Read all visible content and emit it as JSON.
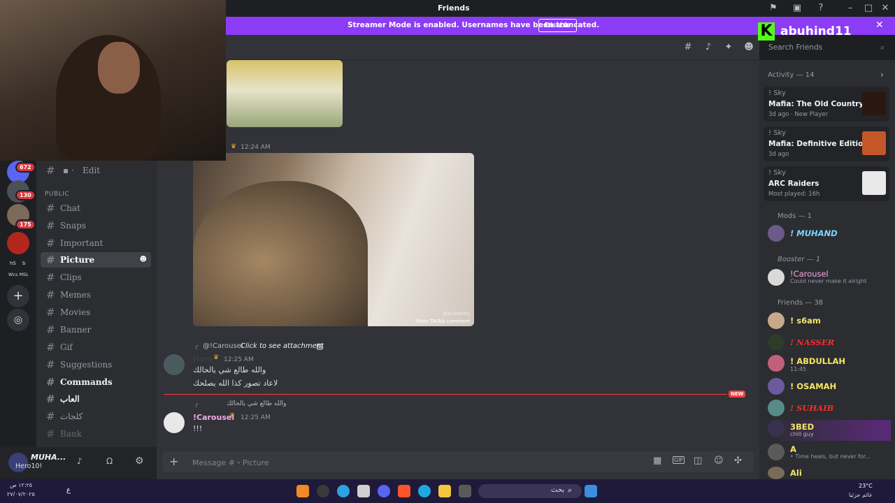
{
  "window": {
    "title": "Friends"
  },
  "banner": {
    "message": "Streamer Mode is enabled. Usernames have been truncated.",
    "disable_label": "Disable"
  },
  "brand": {
    "logo_letter": "K",
    "name": "abuhind11"
  },
  "servers": {
    "badges": [
      "672",
      "130",
      "175"
    ],
    "labels": [
      "hS",
      "b",
      "Wcs MSL"
    ]
  },
  "channels": {
    "edit": "Edit",
    "category_public": "PUBLIC",
    "items": [
      {
        "label": "Chat"
      },
      {
        "label": "Snaps"
      },
      {
        "label": "Important"
      },
      {
        "label": "Picture"
      },
      {
        "label": "Clips"
      },
      {
        "label": "Memes"
      },
      {
        "label": "Movies"
      },
      {
        "label": "Banner"
      },
      {
        "label": "Gif"
      },
      {
        "label": "Suggestions"
      },
      {
        "label": "Commands"
      },
      {
        "label": "العاب"
      },
      {
        "label": "كلجات"
      },
      {
        "label": "Bank"
      }
    ]
  },
  "user_panel": {
    "name": "MUHA...",
    "status": "Hero10!"
  },
  "header": {
    "search_placeholder": "Search Friends"
  },
  "messages": {
    "first_time": "12:24 AM",
    "video_watermark": "@screamfy",
    "video_caption": "From TikTok comment",
    "reply_ref_user": "@!Carousel",
    "reply_ref_text": "Click to see attachment",
    "msg2_author": "Hero",
    "msg2_time": "12:25 AM",
    "msg2_line1": "والله طالع شي يالحالك",
    "msg2_line2": "لاعاد تصور كذا الله يصلحك",
    "new_label": "NEW",
    "msg3_reply": "والله طالع شي يالحالك",
    "msg3_author": "!Carousel",
    "msg3_time": "12:25 AM",
    "msg3_text": "!!!"
  },
  "composer": {
    "placeholder": "Message #・Picture"
  },
  "right": {
    "activity_title": "Activity — 14",
    "activities": [
      {
        "user": "! Sky",
        "game": "Mafia: The Old Country",
        "sub": "3d ago · New Player",
        "art_color": "#2a1810"
      },
      {
        "user": "! Sky",
        "game": "Mafia: Definitive Edition",
        "sub": "3d ago",
        "art_color": "#c4572a"
      },
      {
        "user": "! Sky",
        "game": "ARC Raiders",
        "sub": "Most played: 16h",
        "art_color": "#e9e9e9"
      }
    ],
    "mods_title": "Mods — 1",
    "mods": [
      {
        "name": "! MUHAND",
        "color": "#7dd6ff"
      }
    ],
    "booster_title": "Booster — 1",
    "boosters": [
      {
        "name": "!Carousel",
        "sub": "Could never make it alright",
        "color": "#f7a8e8"
      }
    ],
    "friends_title": "Friends — 38",
    "friends": [
      {
        "name": "! s6am",
        "sub": "",
        "color": "#f5e663"
      },
      {
        "name": "! NASSER",
        "sub": "",
        "color": "#ff2a2a"
      },
      {
        "name": "! ABDULLAH",
        "sub": "11:45",
        "color": "#f5e663"
      },
      {
        "name": "! OSAMAH",
        "sub": "",
        "color": "#f5e663"
      },
      {
        "name": "! SUHAIB",
        "sub": "",
        "color": "#ff2a2a"
      },
      {
        "name": "3BED",
        "sub": "chill guy",
        "color": "#f5e663"
      },
      {
        "name": "A",
        "sub": "• Time heals, but never for...",
        "color": "#f5e663"
      },
      {
        "name": "Ali",
        "sub": "",
        "color": "#f5e663"
      }
    ]
  },
  "taskbar": {
    "time": "١٢:٢٥ ص",
    "date": "٢٧/٠٧/٢٠٢٥",
    "lang": "ع",
    "search": "بحث",
    "temp": "23°C",
    "weather": "غائم جزئيا"
  }
}
